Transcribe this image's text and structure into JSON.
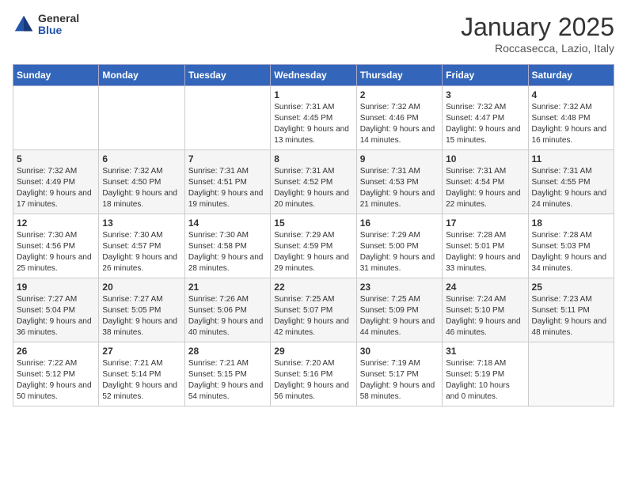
{
  "header": {
    "logo": {
      "general": "General",
      "blue": "Blue"
    },
    "title": "January 2025",
    "subtitle": "Roccasecca, Lazio, Italy"
  },
  "weekdays": [
    "Sunday",
    "Monday",
    "Tuesday",
    "Wednesday",
    "Thursday",
    "Friday",
    "Saturday"
  ],
  "weeks": [
    [
      {
        "day": "",
        "info": ""
      },
      {
        "day": "",
        "info": ""
      },
      {
        "day": "",
        "info": ""
      },
      {
        "day": "1",
        "info": "Sunrise: 7:31 AM\nSunset: 4:45 PM\nDaylight: 9 hours and 13 minutes."
      },
      {
        "day": "2",
        "info": "Sunrise: 7:32 AM\nSunset: 4:46 PM\nDaylight: 9 hours and 14 minutes."
      },
      {
        "day": "3",
        "info": "Sunrise: 7:32 AM\nSunset: 4:47 PM\nDaylight: 9 hours and 15 minutes."
      },
      {
        "day": "4",
        "info": "Sunrise: 7:32 AM\nSunset: 4:48 PM\nDaylight: 9 hours and 16 minutes."
      }
    ],
    [
      {
        "day": "5",
        "info": "Sunrise: 7:32 AM\nSunset: 4:49 PM\nDaylight: 9 hours and 17 minutes."
      },
      {
        "day": "6",
        "info": "Sunrise: 7:32 AM\nSunset: 4:50 PM\nDaylight: 9 hours and 18 minutes."
      },
      {
        "day": "7",
        "info": "Sunrise: 7:31 AM\nSunset: 4:51 PM\nDaylight: 9 hours and 19 minutes."
      },
      {
        "day": "8",
        "info": "Sunrise: 7:31 AM\nSunset: 4:52 PM\nDaylight: 9 hours and 20 minutes."
      },
      {
        "day": "9",
        "info": "Sunrise: 7:31 AM\nSunset: 4:53 PM\nDaylight: 9 hours and 21 minutes."
      },
      {
        "day": "10",
        "info": "Sunrise: 7:31 AM\nSunset: 4:54 PM\nDaylight: 9 hours and 22 minutes."
      },
      {
        "day": "11",
        "info": "Sunrise: 7:31 AM\nSunset: 4:55 PM\nDaylight: 9 hours and 24 minutes."
      }
    ],
    [
      {
        "day": "12",
        "info": "Sunrise: 7:30 AM\nSunset: 4:56 PM\nDaylight: 9 hours and 25 minutes."
      },
      {
        "day": "13",
        "info": "Sunrise: 7:30 AM\nSunset: 4:57 PM\nDaylight: 9 hours and 26 minutes."
      },
      {
        "day": "14",
        "info": "Sunrise: 7:30 AM\nSunset: 4:58 PM\nDaylight: 9 hours and 28 minutes."
      },
      {
        "day": "15",
        "info": "Sunrise: 7:29 AM\nSunset: 4:59 PM\nDaylight: 9 hours and 29 minutes."
      },
      {
        "day": "16",
        "info": "Sunrise: 7:29 AM\nSunset: 5:00 PM\nDaylight: 9 hours and 31 minutes."
      },
      {
        "day": "17",
        "info": "Sunrise: 7:28 AM\nSunset: 5:01 PM\nDaylight: 9 hours and 33 minutes."
      },
      {
        "day": "18",
        "info": "Sunrise: 7:28 AM\nSunset: 5:03 PM\nDaylight: 9 hours and 34 minutes."
      }
    ],
    [
      {
        "day": "19",
        "info": "Sunrise: 7:27 AM\nSunset: 5:04 PM\nDaylight: 9 hours and 36 minutes."
      },
      {
        "day": "20",
        "info": "Sunrise: 7:27 AM\nSunset: 5:05 PM\nDaylight: 9 hours and 38 minutes."
      },
      {
        "day": "21",
        "info": "Sunrise: 7:26 AM\nSunset: 5:06 PM\nDaylight: 9 hours and 40 minutes."
      },
      {
        "day": "22",
        "info": "Sunrise: 7:25 AM\nSunset: 5:07 PM\nDaylight: 9 hours and 42 minutes."
      },
      {
        "day": "23",
        "info": "Sunrise: 7:25 AM\nSunset: 5:09 PM\nDaylight: 9 hours and 44 minutes."
      },
      {
        "day": "24",
        "info": "Sunrise: 7:24 AM\nSunset: 5:10 PM\nDaylight: 9 hours and 46 minutes."
      },
      {
        "day": "25",
        "info": "Sunrise: 7:23 AM\nSunset: 5:11 PM\nDaylight: 9 hours and 48 minutes."
      }
    ],
    [
      {
        "day": "26",
        "info": "Sunrise: 7:22 AM\nSunset: 5:12 PM\nDaylight: 9 hours and 50 minutes."
      },
      {
        "day": "27",
        "info": "Sunrise: 7:21 AM\nSunset: 5:14 PM\nDaylight: 9 hours and 52 minutes."
      },
      {
        "day": "28",
        "info": "Sunrise: 7:21 AM\nSunset: 5:15 PM\nDaylight: 9 hours and 54 minutes."
      },
      {
        "day": "29",
        "info": "Sunrise: 7:20 AM\nSunset: 5:16 PM\nDaylight: 9 hours and 56 minutes."
      },
      {
        "day": "30",
        "info": "Sunrise: 7:19 AM\nSunset: 5:17 PM\nDaylight: 9 hours and 58 minutes."
      },
      {
        "day": "31",
        "info": "Sunrise: 7:18 AM\nSunset: 5:19 PM\nDaylight: 10 hours and 0 minutes."
      },
      {
        "day": "",
        "info": ""
      }
    ]
  ]
}
